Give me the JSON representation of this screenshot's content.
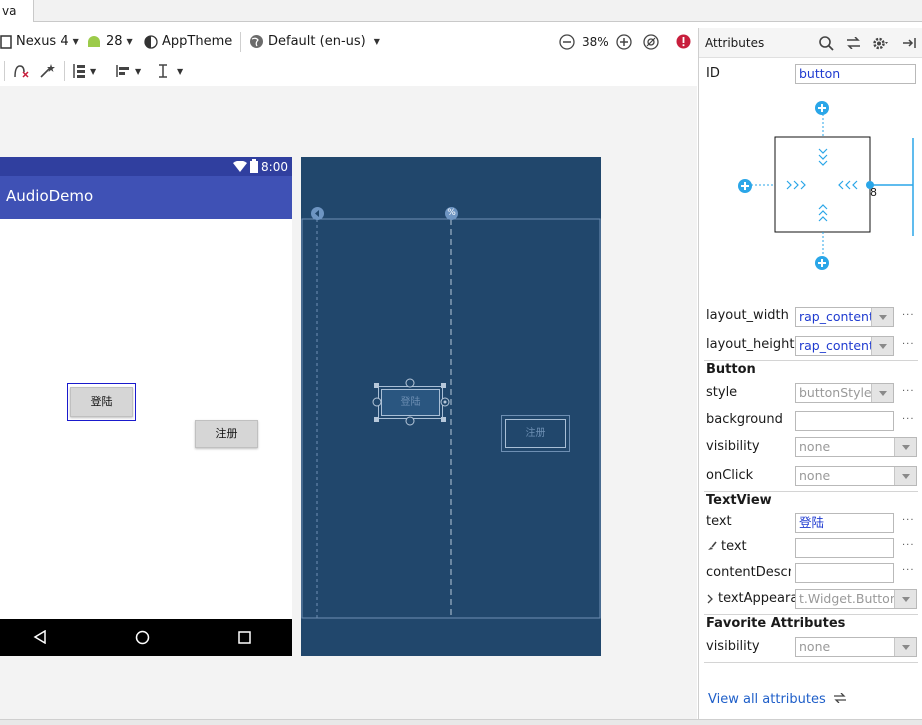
{
  "editor_tab": {
    "label": "va"
  },
  "toolbar": {
    "device": "Nexus 4",
    "api_level": "28",
    "theme": "AppTheme",
    "locale": "Default (en-us)",
    "zoom": "38%"
  },
  "phone": {
    "status_time": "8:00",
    "app_title": "AudioDemo",
    "login_button": "登陆",
    "register_button": "注册"
  },
  "blueprint": {
    "login_button": "登陆",
    "register_button": "注册"
  },
  "panel": {
    "title": "Attributes",
    "id_label": "ID",
    "id_value": "button",
    "margin_value": "8",
    "rows": {
      "layout_width": {
        "label": "layout_width",
        "value": "rap_content"
      },
      "layout_height": {
        "label": "layout_height",
        "value": "rap_content"
      },
      "style": {
        "label": "style",
        "value": "buttonStyle"
      },
      "background": {
        "label": "background",
        "value": ""
      },
      "visibility": {
        "label": "visibility",
        "value": "none"
      },
      "onclick": {
        "label": "onClick",
        "value": "none"
      },
      "text": {
        "label": "text",
        "value": "登陆"
      },
      "tools_text": {
        "label": "text",
        "value": ""
      },
      "content_description": {
        "label": "contentDescrip",
        "value": ""
      },
      "text_appearance": {
        "label": "textAppeara",
        "value": "t.Widget.Button"
      },
      "fav_visibility": {
        "label": "visibility",
        "value": "none"
      }
    },
    "sections": {
      "button": "Button",
      "textview": "TextView",
      "favorite": "Favorite Attributes"
    },
    "more": "···",
    "view_all": "View all attributes"
  },
  "colors": {
    "blueprint_bg": "#21476c",
    "app_bar": "#3f51b5",
    "status_bar": "#303f9f",
    "link": "#1f5fc9"
  }
}
